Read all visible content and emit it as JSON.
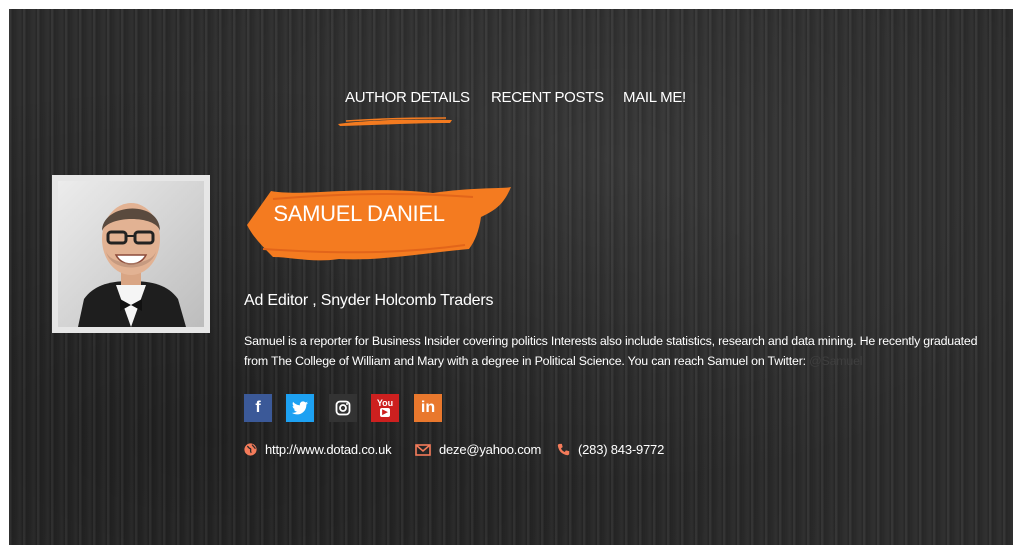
{
  "nav": {
    "items": [
      "AUTHOR DETAILS",
      "RECENT POSTS",
      "MAIL ME!"
    ],
    "active_index": 0
  },
  "author": {
    "name": "SAMUEL DANIEL",
    "role": "Ad Editor , Snyder Holcomb Traders",
    "bio": "Samuel is a reporter for Business Insider covering politics Interests also include statistics, research and data mining. He recently graduated from The College of William and Mary with a degree in Political Science. You can reach Samuel on Twitter:",
    "bio_handle": "@Samuel"
  },
  "socials": [
    {
      "name": "facebook",
      "glyph": "f",
      "color": "#3b5998"
    },
    {
      "name": "twitter",
      "glyph": "t",
      "color": "#1da1f2"
    },
    {
      "name": "instagram",
      "glyph": "ig",
      "color": "#333333"
    },
    {
      "name": "youtube",
      "glyph": "You",
      "color": "#cd201f"
    },
    {
      "name": "linkedin",
      "glyph": "in",
      "color": "#e9782d"
    }
  ],
  "contacts": {
    "website": "http://www.dotad.co.uk",
    "email": "deze@yahoo.com",
    "phone": "(283) 843-9772"
  },
  "colors": {
    "accent": "#f47b20",
    "background": "#2b2b2b",
    "icon": "#f47b5a"
  }
}
